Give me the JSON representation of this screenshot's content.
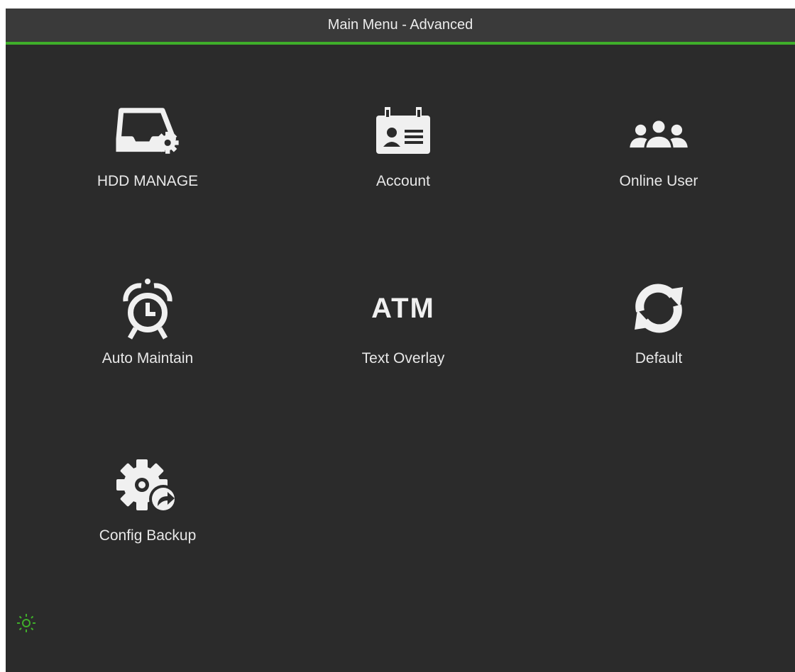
{
  "window": {
    "title": "Main Menu - Advanced"
  },
  "menu": {
    "items": [
      {
        "label": "HDD MANAGE",
        "icon": "hdd-manage-icon"
      },
      {
        "label": "Account",
        "icon": "account-card-icon"
      },
      {
        "label": "Online User",
        "icon": "online-users-icon"
      },
      {
        "label": "Auto Maintain",
        "icon": "alarm-clock-icon"
      },
      {
        "label": "Text Overlay",
        "icon_text": "ATM"
      },
      {
        "label": "Default",
        "icon": "refresh-icon"
      },
      {
        "label": "Config Backup",
        "icon": "gear-export-icon"
      }
    ]
  },
  "status": {
    "icon": "sun-icon",
    "color": "#3fae2a"
  },
  "colors": {
    "background": "#2b2b2b",
    "titlebar": "#3a3a3a",
    "accent": "#3fae2a",
    "text": "#e8e8e8",
    "icon": "#f0f0f0"
  }
}
